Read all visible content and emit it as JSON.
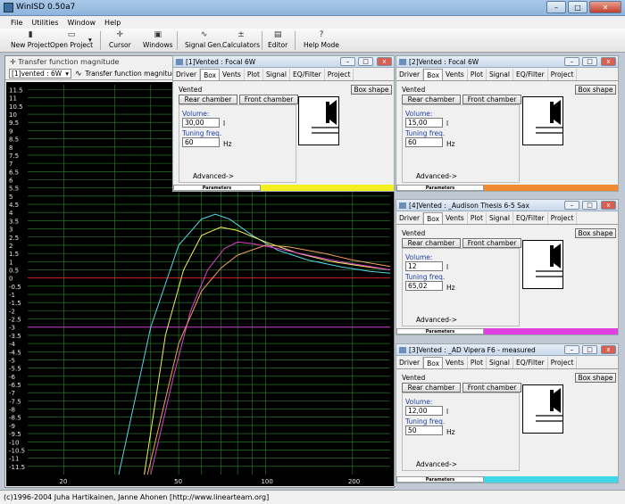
{
  "app": {
    "title": "WinISD 0.50a7"
  },
  "menu": [
    "File",
    "Utilities",
    "Window",
    "Help"
  ],
  "toolbar": {
    "new_project": "New Project",
    "open_project": "Open Project",
    "cursor": "Cursor",
    "windows": "Windows",
    "signal_gen": "Signal Gen.",
    "calculators": "Calculators",
    "editor": "Editor",
    "help_mode": "Help Mode"
  },
  "tf_window": {
    "title": "Transfer function magnitude",
    "project_select": "[1]vented : 6W",
    "graph_label": "Transfer function magnitude"
  },
  "chart_data": {
    "type": "line",
    "xscale": "log",
    "xlim": [
      15,
      270
    ],
    "ylim": [
      -12,
      11.8
    ],
    "x_ticks": [
      "20",
      "50",
      "100",
      "200"
    ],
    "y_ticks": [
      "11.5",
      "11",
      "10.5",
      "10",
      "9.5",
      "9",
      "8.5",
      "8",
      "7.5",
      "7",
      "6.5",
      "6",
      "5.5",
      "5",
      "4.5",
      "4",
      "3.5",
      "3",
      "2.5",
      "2",
      "1.5",
      "1",
      "0.5",
      "0",
      "-0.5",
      "-1",
      "-1.5",
      "-2",
      "-2.5",
      "-3",
      "-3.5",
      "-4",
      "-4.5",
      "-5",
      "-5.5",
      "-6",
      "-6.5",
      "-7",
      "-7.5",
      "-8",
      "-8.5",
      "-9",
      "-9.5",
      "-10",
      "-10.5",
      "-11",
      "-11.5"
    ],
    "grid": true,
    "series": [
      {
        "color": "#55d8e8",
        "x": [
          31,
          40,
          50,
          60,
          67,
          75,
          90,
          110,
          140,
          180,
          230,
          270
        ],
        "y": [
          -12,
          -3,
          2,
          3.6,
          3.9,
          3.6,
          2.6,
          1.7,
          1.1,
          0.7,
          0.4,
          0.3
        ]
      },
      {
        "color": "#f4f060",
        "x": [
          38,
          45,
          52,
          60,
          70,
          80,
          100,
          130,
          170,
          220,
          270
        ],
        "y": [
          -12,
          -3.5,
          0.5,
          2.6,
          3.1,
          2.9,
          2.2,
          1.5,
          1,
          0.7,
          0.5
        ]
      },
      {
        "color": "#e040d0",
        "x": [
          40,
          48,
          55,
          63,
          72,
          80,
          90,
          110,
          140,
          180,
          230,
          270
        ],
        "y": [
          -12,
          -6,
          -2,
          0.5,
          1.8,
          2.2,
          2.1,
          1.8,
          1.4,
          1,
          0.7,
          0.5
        ]
      },
      {
        "color": "#f0a060",
        "x": [
          39,
          50,
          60,
          70,
          80,
          100,
          120,
          160,
          200,
          270
        ],
        "y": [
          -12,
          -4,
          -0.8,
          0.6,
          1.4,
          2,
          1.9,
          1.5,
          1.1,
          0.7
        ]
      }
    ]
  },
  "box_windows": [
    {
      "title": "[1]Vented : Focal 6W",
      "volume": "30,00",
      "tuning": "60",
      "color": "#f4f020"
    },
    {
      "title": "[2]Vented : Focal 6W",
      "volume": "15,00",
      "tuning": "60",
      "color": "#f08a30"
    },
    {
      "title": "[4]Vented : _Audison Thesis 6-5 Sax",
      "volume": "12",
      "tuning": "65,02",
      "color": "#e040e0"
    },
    {
      "title": "[3]Vented : _AD Vipera F6 - measured",
      "volume": "12,00",
      "tuning": "50",
      "color": "#40d8e8"
    }
  ],
  "tabs": [
    "Driver",
    "Box",
    "Vents",
    "Plot",
    "Signal",
    "EQ/Filter",
    "Project"
  ],
  "labels": {
    "vented": "Vented",
    "box_shape": "Box shape",
    "rear_chamber": "Rear chamber",
    "front_chamber": "Front chamber",
    "volume": "Volume:",
    "unit_l": "l",
    "tuning": "Tuning freq.",
    "unit_hz": "Hz",
    "advanced": "Advanced->",
    "parameters": "Parameters"
  },
  "status": "(c)1996-2004 Juha Hartikainen, Janne Ahonen [http://www.linearteam.org]"
}
